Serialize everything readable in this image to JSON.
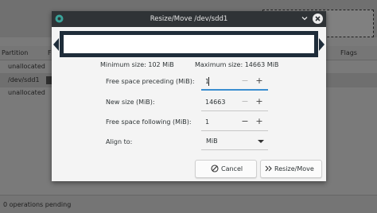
{
  "background": {
    "columns": {
      "partition": "Partition",
      "partition_short": "F",
      "flags": "Flags"
    },
    "rows": [
      "unallocated",
      "/dev/sdd1",
      "unallocated"
    ],
    "status": "0 operations pending"
  },
  "dialog": {
    "title": "Resize/Move /dev/sdd1",
    "min_size": "Minimum size: 102 MiB",
    "max_size": "Maximum size: 14663 MiB",
    "fields": {
      "preceding": {
        "label": "Free space preceding (MiB):",
        "value": "1"
      },
      "new_size": {
        "label": "New size (MiB):",
        "value": "14663"
      },
      "following": {
        "label": "Free space following (MiB):",
        "value": "1"
      },
      "align": {
        "label": "Align to:",
        "value": "MiB"
      }
    },
    "buttons": {
      "cancel": "Cancel",
      "resize": "Resize/Move"
    },
    "symbols": {
      "minus": "−",
      "plus": "+"
    }
  },
  "colors": {
    "titlebar": "#2f3336",
    "partition_bar": "#1f2d3a",
    "focus": "#3b8ed0"
  }
}
